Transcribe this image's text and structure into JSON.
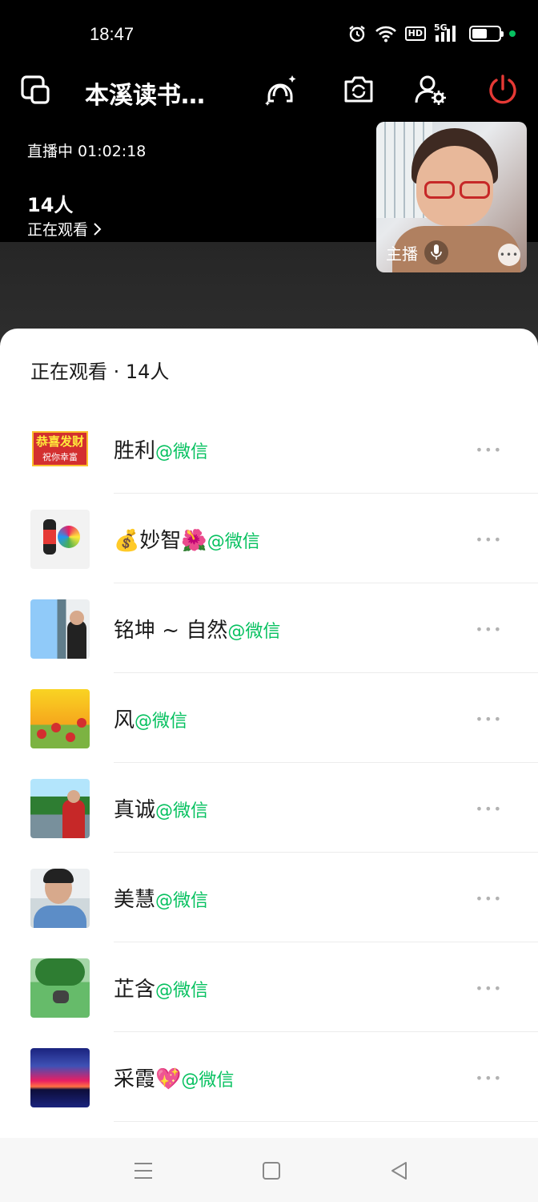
{
  "status_bar": {
    "time": "18:47",
    "hd_badge": "HD",
    "network": "5G",
    "battery_level": 0.55,
    "indicator_color": "#07c160"
  },
  "header": {
    "title": "本溪读书…",
    "icons": [
      "window-switch-icon",
      "beauty-filter-icon",
      "camera-flip-icon",
      "member-settings-icon",
      "power-icon"
    ],
    "power_color": "#e53935"
  },
  "live": {
    "status": "直播中 01:02:18",
    "viewer_count": "14人",
    "viewer_link": "正在观看"
  },
  "host_tile": {
    "label": "主播"
  },
  "sheet": {
    "title": "正在观看 · 14人",
    "viewers": [
      {
        "name": "胜利",
        "source": "@微信"
      },
      {
        "name": "💰妙智🌺",
        "source": "@微信"
      },
      {
        "name": "铭坤 ~ 自然",
        "source": "@微信"
      },
      {
        "name": "风",
        "source": "@微信"
      },
      {
        "name": "真诚",
        "source": "@微信"
      },
      {
        "name": "美慧",
        "source": "@微信"
      },
      {
        "name": "芷含",
        "source": "@微信"
      },
      {
        "name": "采霞💖",
        "source": "@微信"
      }
    ],
    "avatar1_text": [
      "恭喜发财",
      "祝你幸富"
    ]
  },
  "colors": {
    "wechat_green": "#07c160",
    "sheet_bg": "#ffffff",
    "app_bg": "#000000"
  }
}
